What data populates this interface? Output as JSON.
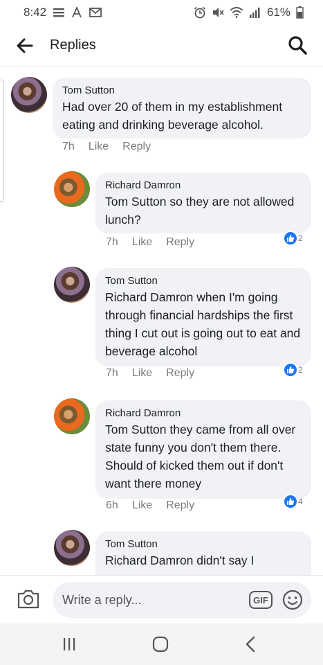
{
  "status_bar": {
    "time": "8:42",
    "battery": "61%"
  },
  "header": {
    "title": "Replies"
  },
  "comments": [
    {
      "author": "Tom Sutton",
      "text": "Had over 20 of them in my establishment eating and drinking beverage alcohol.",
      "time": "7h",
      "like_label": "Like",
      "reply_label": "Reply",
      "reactions": ""
    },
    {
      "author": "Richard Damron",
      "text": "Tom Sutton so they are not allowed lunch?",
      "time": "7h",
      "like_label": "Like",
      "reply_label": "Reply",
      "reactions": "2"
    },
    {
      "author": "Tom Sutton",
      "text": "Richard Damron when I'm going through financial hardships the first thing I cut out is going out to eat and beverage alcohol",
      "time": "7h",
      "like_label": "Like",
      "reply_label": "Reply",
      "reactions": "2"
    },
    {
      "author": "Richard Damron",
      "text": "Tom Sutton they came from all over state funny you don't them there.  Should of kicked them out if don't want there money",
      "time": "6h",
      "like_label": "Like",
      "reply_label": "Reply",
      "reactions": "4"
    },
    {
      "author": "Tom Sutton",
      "text": "Richard Damron didn't say I"
    }
  ],
  "reply_bar": {
    "placeholder": "Write a reply...",
    "gif_label": "GIF"
  },
  "icons": {
    "back": "back-arrow-icon",
    "search": "search-icon",
    "camera": "camera-icon",
    "emoji": "emoji-icon",
    "like": "thumbs-up-icon"
  },
  "colors": {
    "like_blue": "#1a77f2",
    "bubble_bg": "#f0f2f5"
  }
}
